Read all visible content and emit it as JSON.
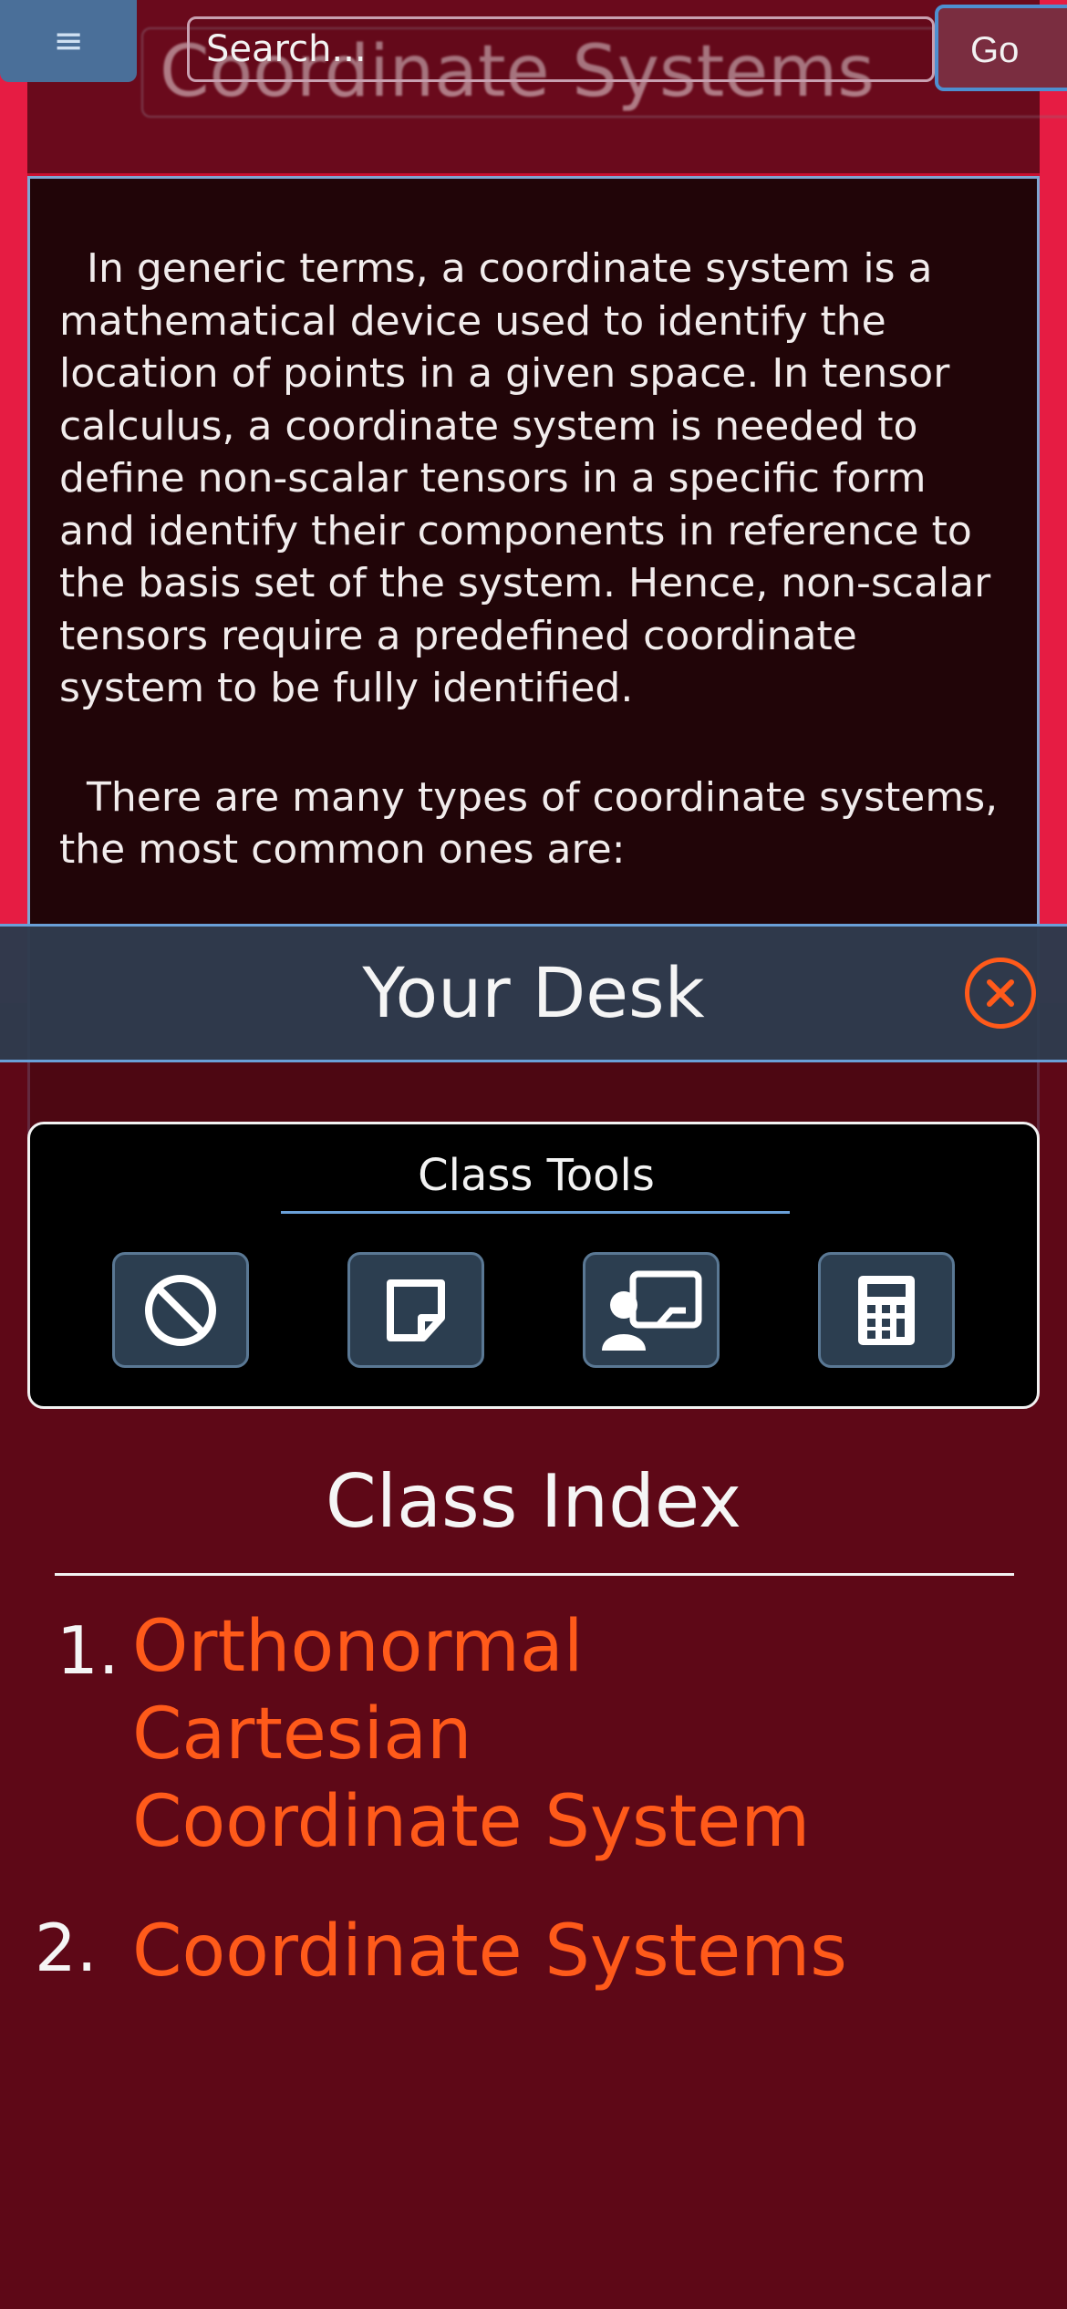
{
  "header": {
    "menu_icon": "hamburger-icon",
    "page_title": "Coordinate Systems",
    "search_placeholder": "Search...",
    "go_label": "Go"
  },
  "content": {
    "paragraph_1": "In generic terms, a coordinate system is a mathematical device used to identify the location of points in a given space. In tensor calculus, a coordinate system is needed to define non-scalar tensors in a specific form and identify their components in reference to the basis set of the system. Hence, non-scalar tensors require a predefined coordinate system to be fully identified.",
    "paragraph_2": "There are many types of coordinate systems, the most common ones are:"
  },
  "desk": {
    "title": "Your Desk",
    "close_icon": "close-circle-icon",
    "tools_heading": "Class Tools",
    "tools": [
      {
        "icon": "block-icon"
      },
      {
        "icon": "note-icon"
      },
      {
        "icon": "presenter-icon"
      },
      {
        "icon": "calculator-icon"
      }
    ],
    "class_index_title": "Class Index",
    "class_index": [
      {
        "num": "1.",
        "lines": [
          "Orthonormal",
          "Cartesian",
          "Coordinate System"
        ]
      },
      {
        "num": "2.",
        "lines": [
          "Coordinate Systems"
        ]
      }
    ]
  },
  "colors": {
    "accent": "#ff5a1a",
    "brand_red": "#e0153c",
    "dark_red": "#6e0a1c",
    "panel_blue": "#2c3e50",
    "highlight_blue": "#6aa0d8"
  }
}
